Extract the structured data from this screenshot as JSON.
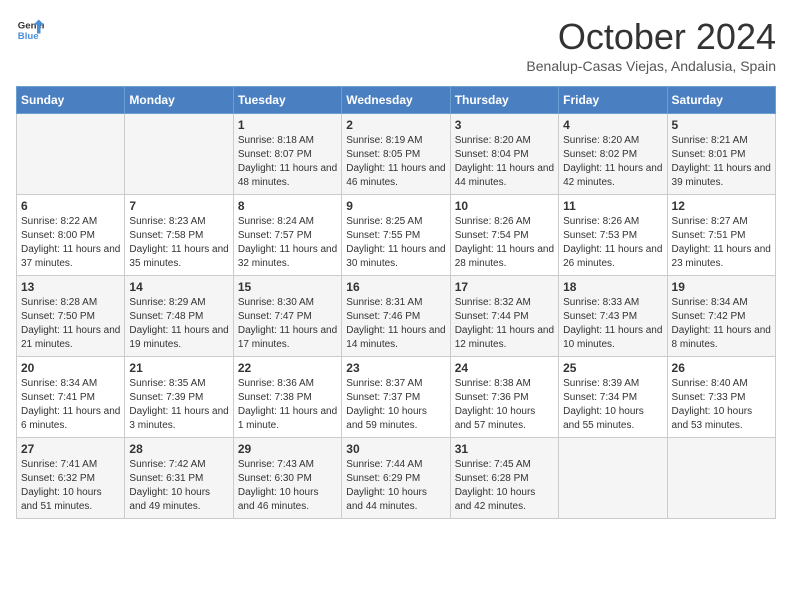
{
  "header": {
    "logo_line1": "General",
    "logo_line2": "Blue",
    "month": "October 2024",
    "location": "Benalup-Casas Viejas, Andalusia, Spain"
  },
  "days_of_week": [
    "Sunday",
    "Monday",
    "Tuesday",
    "Wednesday",
    "Thursday",
    "Friday",
    "Saturday"
  ],
  "weeks": [
    [
      {
        "day": "",
        "text": ""
      },
      {
        "day": "",
        "text": ""
      },
      {
        "day": "1",
        "text": "Sunrise: 8:18 AM\nSunset: 8:07 PM\nDaylight: 11 hours and 48 minutes."
      },
      {
        "day": "2",
        "text": "Sunrise: 8:19 AM\nSunset: 8:05 PM\nDaylight: 11 hours and 46 minutes."
      },
      {
        "day": "3",
        "text": "Sunrise: 8:20 AM\nSunset: 8:04 PM\nDaylight: 11 hours and 44 minutes."
      },
      {
        "day": "4",
        "text": "Sunrise: 8:20 AM\nSunset: 8:02 PM\nDaylight: 11 hours and 42 minutes."
      },
      {
        "day": "5",
        "text": "Sunrise: 8:21 AM\nSunset: 8:01 PM\nDaylight: 11 hours and 39 minutes."
      }
    ],
    [
      {
        "day": "6",
        "text": "Sunrise: 8:22 AM\nSunset: 8:00 PM\nDaylight: 11 hours and 37 minutes."
      },
      {
        "day": "7",
        "text": "Sunrise: 8:23 AM\nSunset: 7:58 PM\nDaylight: 11 hours and 35 minutes."
      },
      {
        "day": "8",
        "text": "Sunrise: 8:24 AM\nSunset: 7:57 PM\nDaylight: 11 hours and 32 minutes."
      },
      {
        "day": "9",
        "text": "Sunrise: 8:25 AM\nSunset: 7:55 PM\nDaylight: 11 hours and 30 minutes."
      },
      {
        "day": "10",
        "text": "Sunrise: 8:26 AM\nSunset: 7:54 PM\nDaylight: 11 hours and 28 minutes."
      },
      {
        "day": "11",
        "text": "Sunrise: 8:26 AM\nSunset: 7:53 PM\nDaylight: 11 hours and 26 minutes."
      },
      {
        "day": "12",
        "text": "Sunrise: 8:27 AM\nSunset: 7:51 PM\nDaylight: 11 hours and 23 minutes."
      }
    ],
    [
      {
        "day": "13",
        "text": "Sunrise: 8:28 AM\nSunset: 7:50 PM\nDaylight: 11 hours and 21 minutes."
      },
      {
        "day": "14",
        "text": "Sunrise: 8:29 AM\nSunset: 7:48 PM\nDaylight: 11 hours and 19 minutes."
      },
      {
        "day": "15",
        "text": "Sunrise: 8:30 AM\nSunset: 7:47 PM\nDaylight: 11 hours and 17 minutes."
      },
      {
        "day": "16",
        "text": "Sunrise: 8:31 AM\nSunset: 7:46 PM\nDaylight: 11 hours and 14 minutes."
      },
      {
        "day": "17",
        "text": "Sunrise: 8:32 AM\nSunset: 7:44 PM\nDaylight: 11 hours and 12 minutes."
      },
      {
        "day": "18",
        "text": "Sunrise: 8:33 AM\nSunset: 7:43 PM\nDaylight: 11 hours and 10 minutes."
      },
      {
        "day": "19",
        "text": "Sunrise: 8:34 AM\nSunset: 7:42 PM\nDaylight: 11 hours and 8 minutes."
      }
    ],
    [
      {
        "day": "20",
        "text": "Sunrise: 8:34 AM\nSunset: 7:41 PM\nDaylight: 11 hours and 6 minutes."
      },
      {
        "day": "21",
        "text": "Sunrise: 8:35 AM\nSunset: 7:39 PM\nDaylight: 11 hours and 3 minutes."
      },
      {
        "day": "22",
        "text": "Sunrise: 8:36 AM\nSunset: 7:38 PM\nDaylight: 11 hours and 1 minute."
      },
      {
        "day": "23",
        "text": "Sunrise: 8:37 AM\nSunset: 7:37 PM\nDaylight: 10 hours and 59 minutes."
      },
      {
        "day": "24",
        "text": "Sunrise: 8:38 AM\nSunset: 7:36 PM\nDaylight: 10 hours and 57 minutes."
      },
      {
        "day": "25",
        "text": "Sunrise: 8:39 AM\nSunset: 7:34 PM\nDaylight: 10 hours and 55 minutes."
      },
      {
        "day": "26",
        "text": "Sunrise: 8:40 AM\nSunset: 7:33 PM\nDaylight: 10 hours and 53 minutes."
      }
    ],
    [
      {
        "day": "27",
        "text": "Sunrise: 7:41 AM\nSunset: 6:32 PM\nDaylight: 10 hours and 51 minutes."
      },
      {
        "day": "28",
        "text": "Sunrise: 7:42 AM\nSunset: 6:31 PM\nDaylight: 10 hours and 49 minutes."
      },
      {
        "day": "29",
        "text": "Sunrise: 7:43 AM\nSunset: 6:30 PM\nDaylight: 10 hours and 46 minutes."
      },
      {
        "day": "30",
        "text": "Sunrise: 7:44 AM\nSunset: 6:29 PM\nDaylight: 10 hours and 44 minutes."
      },
      {
        "day": "31",
        "text": "Sunrise: 7:45 AM\nSunset: 6:28 PM\nDaylight: 10 hours and 42 minutes."
      },
      {
        "day": "",
        "text": ""
      },
      {
        "day": "",
        "text": ""
      }
    ]
  ]
}
